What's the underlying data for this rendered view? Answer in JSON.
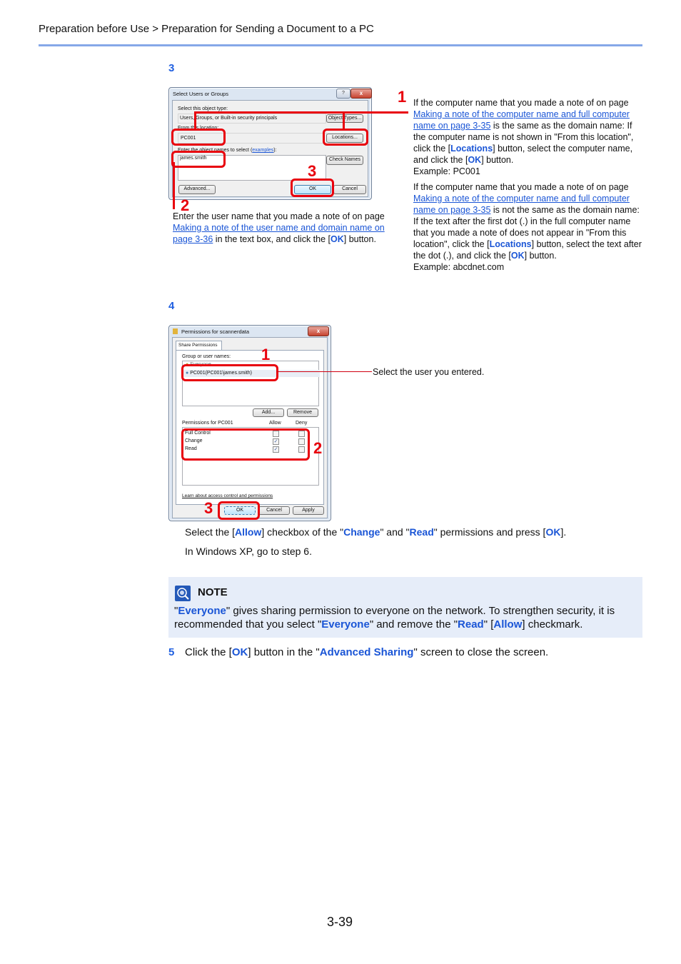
{
  "header": {
    "breadcrumb": "Preparation before Use > Preparation for Sending a Document to a PC"
  },
  "step3": {
    "number": "3",
    "dialog": {
      "title": "Select Users or Groups",
      "help_label": "?",
      "close_label": "x",
      "object_type_label": "Select this object type:",
      "object_type_value": "Users, Groups, or Built-in security principals",
      "object_types_button": "Object Types...",
      "location_label": "From this location:",
      "location_value": "PC001",
      "locations_button": "Locations...",
      "names_label": "Enter the object names to select",
      "examples_link": "examples",
      "names_value": "james.smith",
      "check_names_button": "Check Names",
      "advanced_button": "Advanced...",
      "ok_button": "OK",
      "cancel_button": "Cancel"
    },
    "callouts": {
      "c1": "1",
      "c2": "2",
      "c3": "3"
    },
    "note2": {
      "pre": "Enter the user name that you made a note of on page ",
      "link": "Making a note of the user name and domain name on page 3-36",
      "mid": " in the text box, and click the [",
      "ok": "OK",
      "post": "] button."
    },
    "note1a": {
      "pre": "If the computer name that you made a note of on page ",
      "link": "Making a note of the computer name and full computer name on page 3-35",
      "mid": " is the same as the domain name: If the computer name is not shown in \"From this location\", click the [",
      "locations": "Locations",
      "mid2": "] button, select the computer name, and click the [",
      "ok": "OK",
      "post": "] button.",
      "example": "Example: PC001"
    },
    "note1b": {
      "pre": "If the computer name that you made a note of on page ",
      "link": "Making a note of the computer name and full computer name on page 3-35",
      "mid": " is not the same as the domain name: If the text after the first dot (.) in the full computer name that you made a note of does not appear in \"From this location\", click the [",
      "locations": "Locations",
      "mid2": "] button, select the text after the dot (.), and click the [",
      "ok": "OK",
      "post": "] button.",
      "example": "Example: abcdnet.com"
    }
  },
  "step4": {
    "number": "4",
    "dialog": {
      "title": "Permissions for scannerdata",
      "close_label": "x",
      "tab_label": "Share Permissions",
      "group_label": "Group or user names:",
      "users": [
        {
          "name": "Everyone"
        },
        {
          "name": "PC001(PC001\\james.smith)"
        }
      ],
      "add_button": "Add...",
      "remove_button": "Remove",
      "permissions_label": "Permissions for PC001",
      "allow_header": "Allow",
      "deny_header": "Deny",
      "permissions": [
        {
          "name": "Full Control",
          "allow": false,
          "deny": false
        },
        {
          "name": "Change",
          "allow": true,
          "deny": false
        },
        {
          "name": "Read",
          "allow": true,
          "deny": false
        }
      ],
      "learn_link": "Learn about access control and permissions",
      "ok_button": "OK",
      "cancel_button": "Cancel",
      "apply_button": "Apply"
    },
    "callouts": {
      "c1": "1",
      "c2": "2",
      "c3": "3"
    },
    "select_user_note": "Select the user you entered.",
    "instruction": {
      "pre": "Select the [",
      "allow": "Allow",
      "mid1": "] checkbox of the \"",
      "change": "Change",
      "mid2": "\" and \"",
      "read": "Read",
      "mid3": "\" permissions and press [",
      "ok": "OK",
      "post": "]."
    },
    "xp_note": "In Windows XP, go to step 6."
  },
  "note": {
    "title": "NOTE",
    "q1": "\"",
    "everyone1": "Everyone",
    "t1": "\" gives sharing permission to everyone on the network. To strengthen security, it is recommended that you select \"",
    "everyone2": "Everyone",
    "t2": "\" and remove the \"",
    "read": "Read",
    "t3": "\" [",
    "allow": "Allow",
    "t4": "] checkmark."
  },
  "step5": {
    "number": "5",
    "pre": "Click the [",
    "ok": "OK",
    "mid": "] button in the \"",
    "advanced": "Advanced Sharing",
    "post": "\" screen to close the screen."
  },
  "footer": {
    "page_number": "3-39"
  }
}
